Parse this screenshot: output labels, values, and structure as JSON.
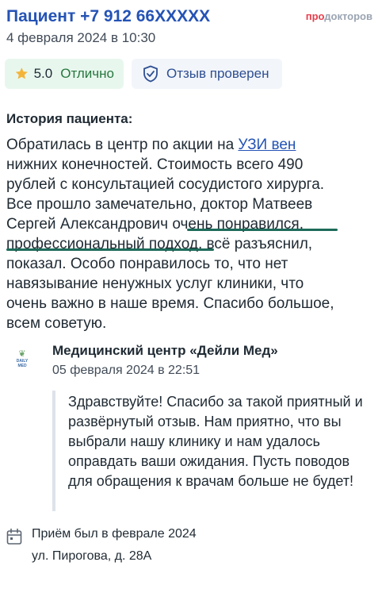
{
  "header": {
    "patient_title": "Пациент +7 912 66XXXXX",
    "date": "4 февраля 2024 в 10:30",
    "brand_accent": "про",
    "brand_rest": "докторов"
  },
  "badges": {
    "rating_score": "5.0",
    "rating_label": "Отлично",
    "verified_label": "Отзыв проверен"
  },
  "review": {
    "section_title": "История пациента:",
    "text_start": "Обратилась в центр по акции на ",
    "link_text": "УЗИ вен",
    "text_middle": " нижних конечностей. Стоимость всего 490 рублей с консультацией сосудистого хирурга. Все прошло замечательно, доктор Матвеев Сергей Александрович ",
    "highlight_1": "очень понравился",
    "comma": ",",
    "highlight_2": "профессиональный подход",
    "text_end": ", всё разъяснил, показал. Особо понравилось то, что нет навязывание ненужных услуг клиники, что очень важно в наше время. Спасибо большое, всем советую."
  },
  "clinic": {
    "logo_text": "DAILY MED",
    "name": "Медицинский центр «Дейли Мед»",
    "date": "05 февраля 2024 в 22:51"
  },
  "reply": {
    "text": "Здравствуйте! Спасибо за такой приятный и развёрнутый отзыв. Нам приятно, что вы выбрали нашу клинику и нам удалось оправдать ваши ожидания. Пусть поводов для обращения к врачам больше не будет!"
  },
  "visit": {
    "label": "Приём был в феврале 2024",
    "address": "ул. Пирогова, д. 28А"
  },
  "colors": {
    "accent_blue": "#2453b5",
    "rating_green": "#27773f",
    "highlight_underline": "#1e6b5a",
    "star": "#f4b43a"
  }
}
